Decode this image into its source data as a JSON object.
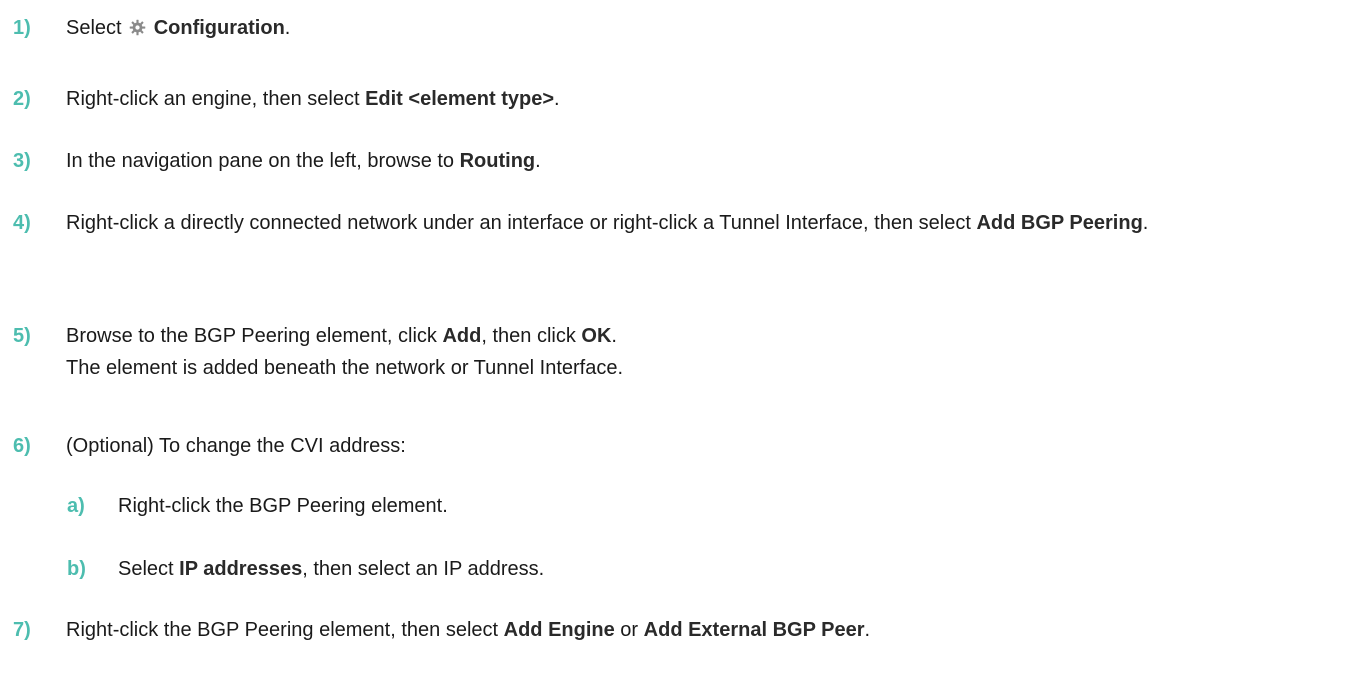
{
  "steps": [
    {
      "num": "1)",
      "parts": [
        {
          "t": "Select ",
          "b": false
        },
        {
          "icon": "gear-icon"
        },
        {
          "t": " Configuration",
          "b": true
        },
        {
          "t": ".",
          "b": false
        }
      ]
    },
    {
      "num": "2)",
      "parts": [
        {
          "t": "Right-click an engine, then select ",
          "b": false
        },
        {
          "t": "Edit <element type>",
          "b": true
        },
        {
          "t": ".",
          "b": false
        }
      ]
    },
    {
      "num": "3)",
      "parts": [
        {
          "t": "In the navigation pane on the left, browse to ",
          "b": false
        },
        {
          "t": "Routing",
          "b": true
        },
        {
          "t": ".",
          "b": false
        }
      ]
    },
    {
      "num": "4)",
      "parts": [
        {
          "t": "Right-click a directly connected network under an interface or right-click a Tunnel Interface, then select ",
          "b": false
        },
        {
          "t": "Add BGP Peering",
          "b": true
        },
        {
          "t": ".",
          "b": false
        }
      ]
    },
    {
      "num": "5)",
      "parts": [
        {
          "t": "Browse to the BGP Peering element, click ",
          "b": false
        },
        {
          "t": "Add",
          "b": true
        },
        {
          "t": ", then click ",
          "b": false
        },
        {
          "t": "OK",
          "b": true
        },
        {
          "t": ".",
          "b": false
        }
      ],
      "result": "The element is added beneath the network or Tunnel Interface."
    },
    {
      "num": "6)",
      "parts": [
        {
          "t": "(Optional) To change the CVI address:",
          "b": false
        }
      ]
    },
    {
      "num": "a)",
      "sub": true,
      "parts": [
        {
          "t": "Right-click the BGP Peering element.",
          "b": false
        }
      ]
    },
    {
      "num": "b)",
      "sub": true,
      "parts": [
        {
          "t": "Select ",
          "b": false
        },
        {
          "t": "IP addresses",
          "b": true
        },
        {
          "t": ", then select an IP address.",
          "b": false
        }
      ]
    },
    {
      "num": "7)",
      "parts": [
        {
          "t": "Right-click the BGP Peering element, then select ",
          "b": false
        },
        {
          "t": "Add Engine",
          "b": true
        },
        {
          "t": " or ",
          "b": false
        },
        {
          "t": "Add External BGP Peer",
          "b": true
        },
        {
          "t": ".",
          "b": false
        }
      ]
    }
  ],
  "colors": {
    "step_number": "#4dbdaf",
    "text": "#1a1a1a",
    "icon": "#8a8a8a"
  }
}
